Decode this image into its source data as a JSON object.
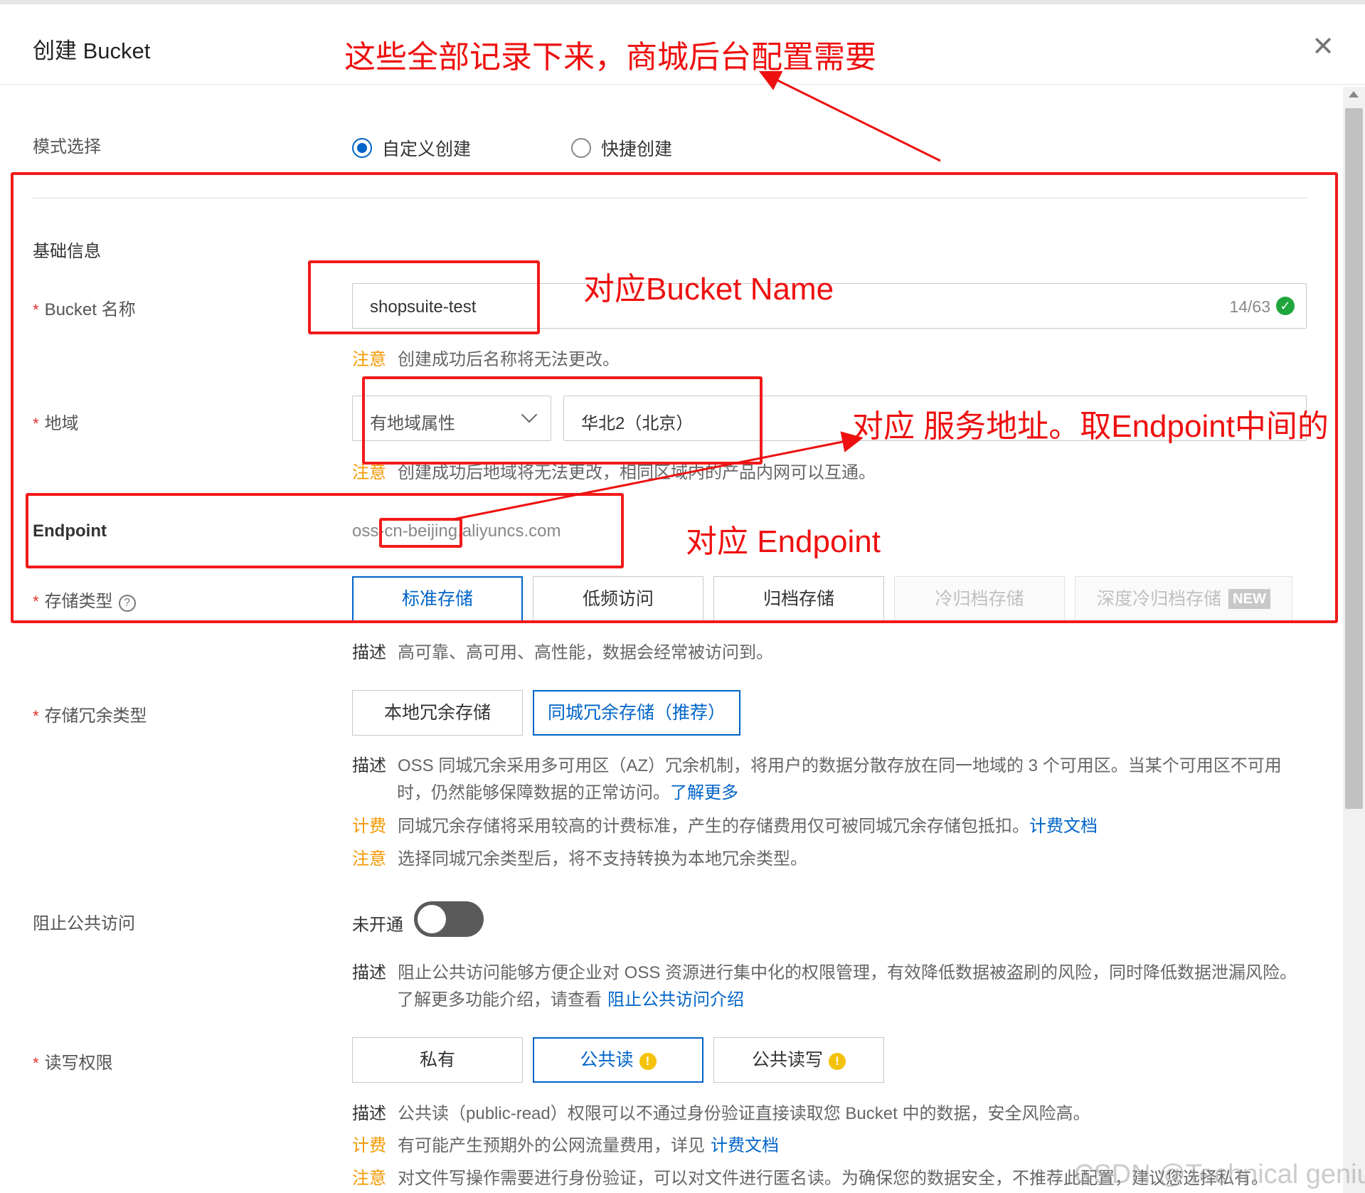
{
  "dialog": {
    "title": "创建 Bucket",
    "close_icon": "close-icon"
  },
  "annotations": {
    "top": "这些全部记录下来，商城后台配置需要",
    "bucket_name": "对应Bucket Name",
    "region": "对应 服务地址。取Endpoint中间的",
    "endpoint": "对应 Endpoint",
    "color": "#ee1010"
  },
  "mode": {
    "label": "模式选择",
    "options": [
      "自定义创建",
      "快捷创建"
    ],
    "selected": "自定义创建"
  },
  "basic_info": {
    "title": "基础信息"
  },
  "bucket_name": {
    "required_mark": "*",
    "label": "Bucket 名称",
    "value": "shopsuite-test",
    "count": "14/63",
    "note_tag": "注意",
    "note": "创建成功后名称将无法更改。"
  },
  "region": {
    "required_mark": "*",
    "label": "地域",
    "type_value": "有地域属性",
    "region_value": "华北2（北京）",
    "note_tag": "注意",
    "note": "创建成功后地域将无法更改，相同区域内的产品内网可以互通。"
  },
  "endpoint": {
    "label": "Endpoint",
    "value": "oss-cn-beijing.aliyuncs.com"
  },
  "storage_class": {
    "required_mark": "*",
    "label": "存储类型",
    "help_icon": "question-circle-icon",
    "options": [
      "标准存储",
      "低频访问",
      "归档存储",
      "冷归档存储",
      "深度冷归档存储"
    ],
    "new_badge": "NEW",
    "selected": "标准存储",
    "desc_tag": "描述",
    "desc": "高可靠、高可用、高性能，数据会经常被访问到。"
  },
  "redundancy": {
    "required_mark": "*",
    "label": "存储冗余类型",
    "options": [
      "本地冗余存储",
      "同城冗余存储（推荐）"
    ],
    "selected": "同城冗余存储（推荐）",
    "desc_tag": "描述",
    "desc_line1": "OSS 同城冗余采用多可用区（AZ）冗余机制，将用户的数据分散存放在同一地域的 3 个可用区。当某个可用区不可用",
    "desc_line2": "时，仍然能够保障数据的正常访问。",
    "learn_more": "了解更多",
    "billing_tag": "计费",
    "billing": "同城冗余存储将采用较高的计费标准，产生的存储费用仅可被同城冗余存储包抵扣。",
    "billing_link": "计费文档",
    "note_tag": "注意",
    "note": "选择同城冗余类型后，将不支持转换为本地冗余类型。"
  },
  "block_public": {
    "label": "阻止公共访问",
    "toggle_label": "未开通",
    "enabled": false,
    "desc_tag": "描述",
    "desc_line1": "阻止公共访问能够方便企业对 OSS 资源进行集中化的权限管理，有效降低数据被盗刷的风险，同时降低数据泄漏风险。",
    "desc_line2": "了解更多功能介绍，请查看",
    "link": "阻止公共访问介绍"
  },
  "acl": {
    "required_mark": "*",
    "label": "读写权限",
    "options": [
      "私有",
      "公共读",
      "公共读写"
    ],
    "selected": "公共读",
    "warn_icon": "warning-circle-icon",
    "desc_tag": "描述",
    "desc": "公共读（public-read）权限可以不通过身份验证直接读取您 Bucket 中的数据，安全风险高。",
    "billing_tag": "计费",
    "billing": "有可能产生预期外的公网流量费用，详见",
    "billing_link": "计费文档",
    "note_tag": "注意",
    "note": "对文件写操作需要进行身份验证，可以对文件进行匿名读。为确保您的数据安全，不推荐此配置，建议您选择私有。"
  },
  "watermark": "CSDN @Technical genius",
  "colors": {
    "accent": "#0064c8",
    "warning": "#f39800",
    "success": "#1ea63c",
    "annotation": "#ee1010"
  }
}
